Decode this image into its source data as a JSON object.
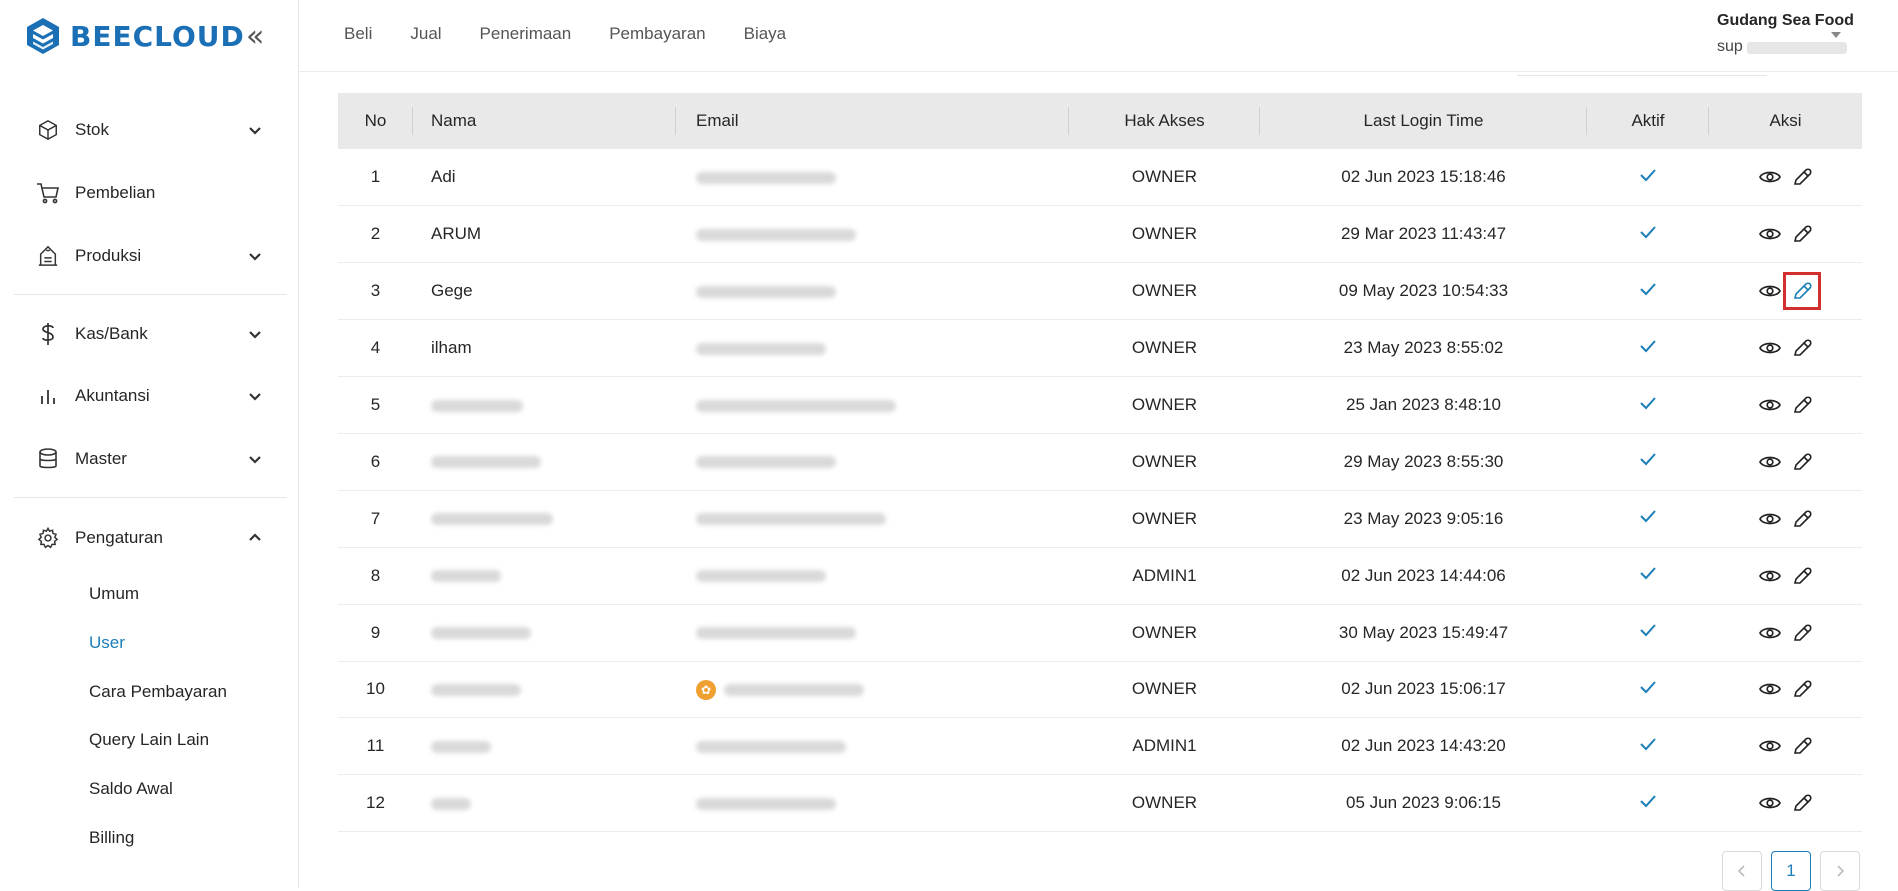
{
  "app": {
    "brand": "BEECLOUD",
    "brand_color": "#1b6fb5",
    "accent_color": "#1b7fb8"
  },
  "sidebar": {
    "collapse_icon": "double-chevron-left-icon",
    "items": [
      {
        "label": "Stok",
        "icon": "cube-icon",
        "expandable": true
      },
      {
        "label": "Pembelian",
        "icon": "cart-icon",
        "expandable": false
      },
      {
        "label": "Produksi",
        "icon": "factory-icon",
        "expandable": true
      },
      {
        "label": "Kas/Bank",
        "icon": "dollar-icon",
        "expandable": true
      },
      {
        "label": "Akuntansi",
        "icon": "bar-chart-icon",
        "expandable": true
      },
      {
        "label": "Master",
        "icon": "database-icon",
        "expandable": true
      },
      {
        "label": "Pengaturan",
        "icon": "gear-icon",
        "expandable": true,
        "expanded": true
      }
    ],
    "submenu": [
      {
        "label": "Umum"
      },
      {
        "label": "User",
        "active": true
      },
      {
        "label": "Cara Pembayaran"
      },
      {
        "label": "Query Lain Lain"
      },
      {
        "label": "Saldo Awal"
      },
      {
        "label": "Billing"
      }
    ]
  },
  "header": {
    "nav": [
      "Beli",
      "Jual",
      "Penerimaan",
      "Pembayaran",
      "Biaya"
    ],
    "user_name": "Gudang Sea Food",
    "user_sub_prefix": "sup"
  },
  "table": {
    "columns": [
      "No",
      "Nama",
      "Email",
      "Hak Akses",
      "Last Login Time",
      "Aktif",
      "Aksi"
    ],
    "rows": [
      {
        "no": "1",
        "nama": "Adi",
        "hak": "OWNER",
        "login": "02 Jun 2023 15:18:46",
        "aktif": true
      },
      {
        "no": "2",
        "nama": "ARUM",
        "hak": "OWNER",
        "login": "29 Mar 2023 11:43:47",
        "aktif": true
      },
      {
        "no": "3",
        "nama": "Gege",
        "hak": "OWNER",
        "login": "09 May 2023 10:54:33",
        "aktif": true
      },
      {
        "no": "4",
        "nama": "ilham",
        "hak": "OWNER",
        "login": "23 May 2023 8:55:02",
        "aktif": true
      },
      {
        "no": "5",
        "nama": "",
        "hak": "OWNER",
        "login": "25 Jan 2023 8:48:10",
        "aktif": true
      },
      {
        "no": "6",
        "nama": "",
        "hak": "OWNER",
        "login": "29 May 2023 8:55:30",
        "aktif": true
      },
      {
        "no": "7",
        "nama": "",
        "hak": "OWNER",
        "login": "23 May 2023 9:05:16",
        "aktif": true
      },
      {
        "no": "8",
        "nama": "",
        "hak": "ADMIN1",
        "login": "02 Jun 2023 14:44:06",
        "aktif": true
      },
      {
        "no": "9",
        "nama": "",
        "hak": "OWNER",
        "login": "30 May 2023 15:49:47",
        "aktif": true
      },
      {
        "no": "10",
        "nama": "",
        "hak": "OWNER",
        "login": "02 Jun 2023 15:06:17",
        "aktif": true
      },
      {
        "no": "11",
        "nama": "",
        "hak": "ADMIN1",
        "login": "02 Jun 2023 14:43:20",
        "aktif": true
      },
      {
        "no": "12",
        "nama": "",
        "hak": "OWNER",
        "login": "05 Jun 2023 9:06:15",
        "aktif": true
      }
    ]
  },
  "pagination": {
    "current": "1"
  }
}
